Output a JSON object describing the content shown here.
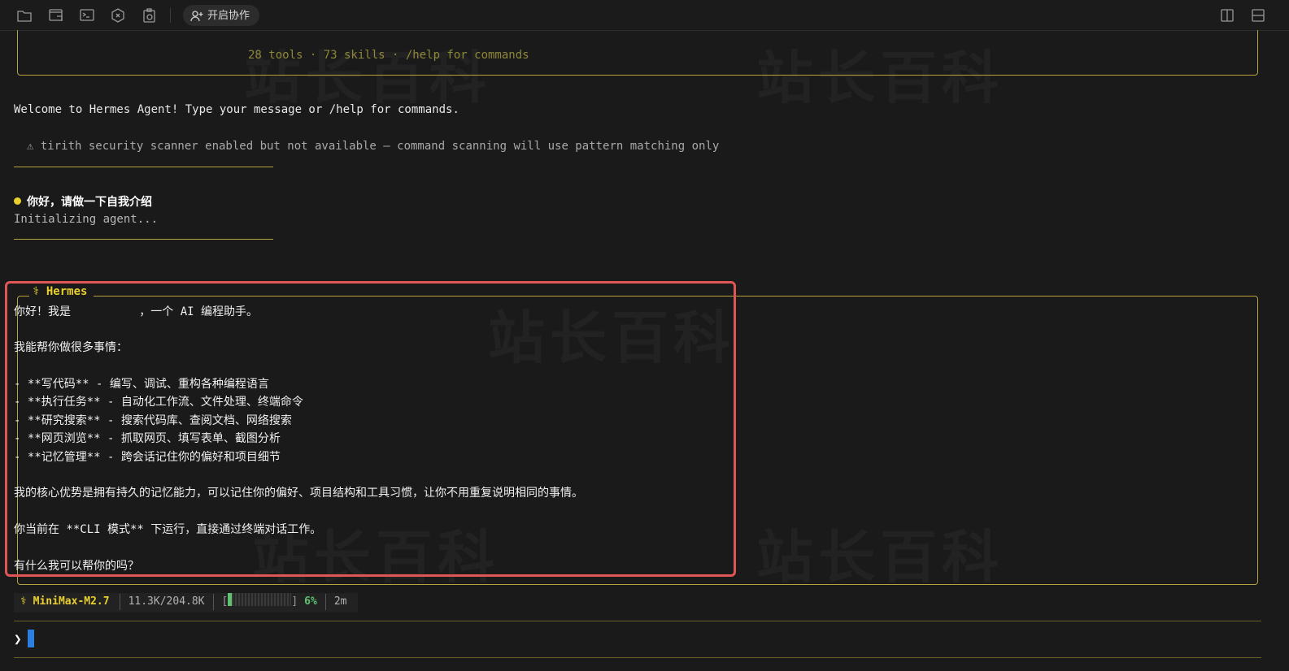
{
  "toolbar": {
    "icons": [
      "sftp-folder-icon",
      "window-icon",
      "terminal-icon",
      "hexagon-icon",
      "clipboard-icon"
    ],
    "icon_labels": [
      "SFTP",
      "",
      "Tmux",
      "",
      ""
    ],
    "collab_label": "开启协作",
    "right_icons": [
      "split-vertical-icon",
      "split-horizontal-icon"
    ]
  },
  "header": {
    "tools_line": "28 tools · 73 skills · /help for commands"
  },
  "messages": {
    "welcome": "Welcome to Hermes Agent! Type your message or /help for commands.",
    "warning": "⚠ tirith security scanner enabled but not available — command scanning will use pattern matching only",
    "user_prompt": "你好，请做一下自我介绍",
    "initializing": "Initializing agent..."
  },
  "response": {
    "title": "⚕ Hermes",
    "lines": [
      "你好！我是          ，一个 AI 编程助手。",
      "",
      "我能帮你做很多事情：",
      "",
      "- **写代码** - 编写、调试、重构各种编程语言",
      "- **执行任务** - 自动化工作流、文件处理、终端命令",
      "- **研究搜索** - 搜索代码库、查阅文档、网络搜索",
      "- **网页浏览** - 抓取网页、填写表单、截图分析",
      "- **记忆管理** - 跨会话记住你的偏好和项目细节",
      "",
      "我的核心优势是拥有持久的记忆能力，可以记住你的偏好、项目结构和工具习惯，让你不用重复说明相同的事情。",
      "",
      "你当前在 **CLI 模式** 下运行，直接通过终端对话工作。",
      "",
      "有什么我可以帮你的吗？"
    ]
  },
  "status": {
    "model": "⚕ MiniMax-M2.7",
    "tokens": "11.3K/204.8K",
    "context_open": "[",
    "context_close": "]",
    "context_fraction": 0.06,
    "context_percent": "6%",
    "elapsed": "2m"
  },
  "input": {
    "prompt_symbol": "❯"
  },
  "watermark": "站长百科",
  "colors": {
    "accent_yellow": "#e8cf2e",
    "border_gold": "#b5a33d",
    "highlight_red": "#e05656",
    "progress_green": "#5ec26f",
    "caret_blue": "#2b7fe0"
  }
}
